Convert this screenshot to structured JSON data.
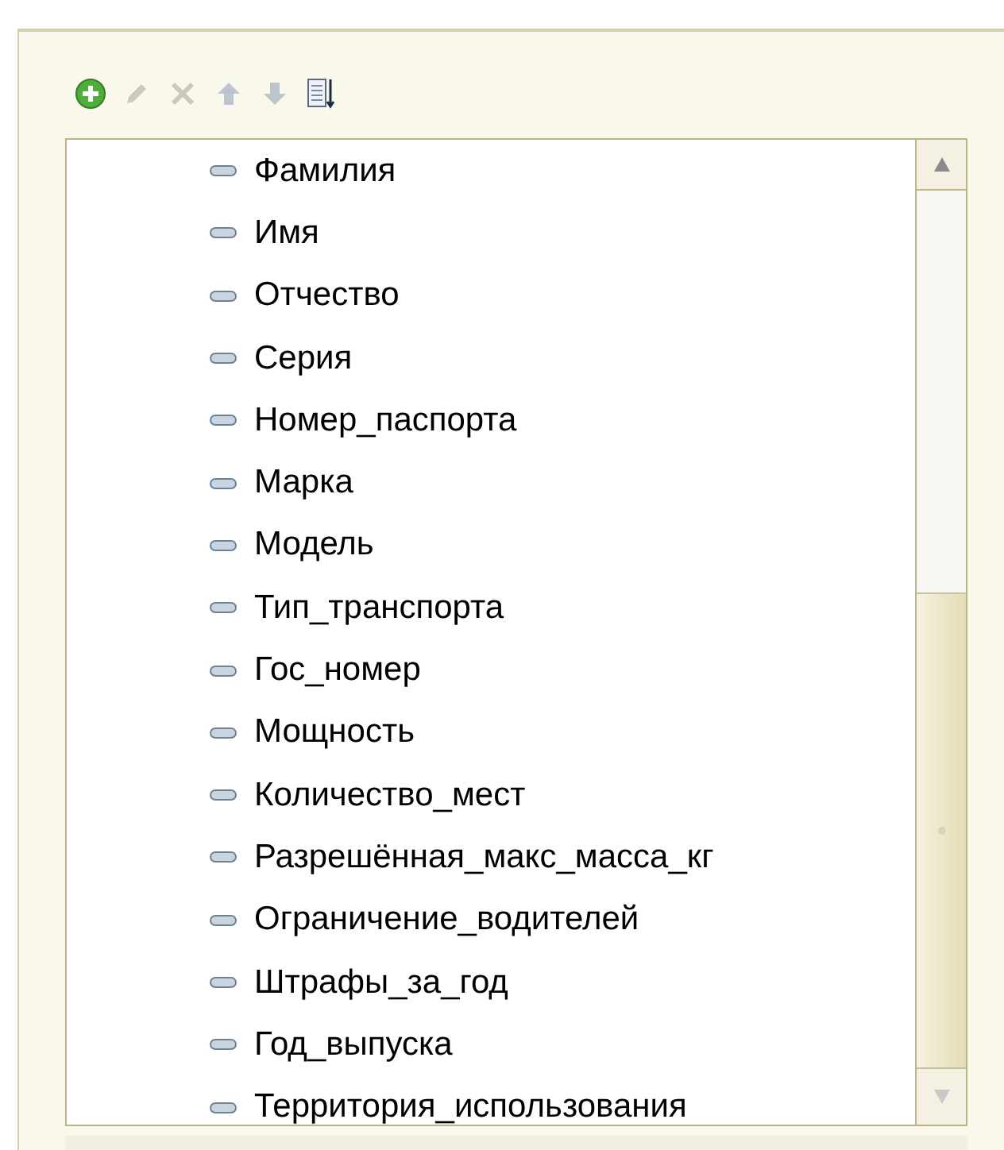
{
  "toolbar": [
    {
      "kind": "add",
      "disabled": false
    },
    {
      "kind": "edit",
      "disabled": true
    },
    {
      "kind": "delete",
      "disabled": true
    },
    {
      "kind": "up",
      "disabled": true
    },
    {
      "kind": "down",
      "disabled": true
    },
    {
      "kind": "list",
      "disabled": false
    }
  ],
  "items": [
    "Фамилия",
    "Имя",
    "Отчество",
    "Серия",
    "Номер_паспорта",
    "Марка",
    "Модель",
    "Тип_транспорта",
    "Гос_номер",
    "Мощность",
    "Количество_мест",
    "Разрешённая_макс_масса_кг",
    "Ограничение_водителей",
    "Штрафы_за_год",
    "Год_выпуска",
    "Территория_использования"
  ]
}
